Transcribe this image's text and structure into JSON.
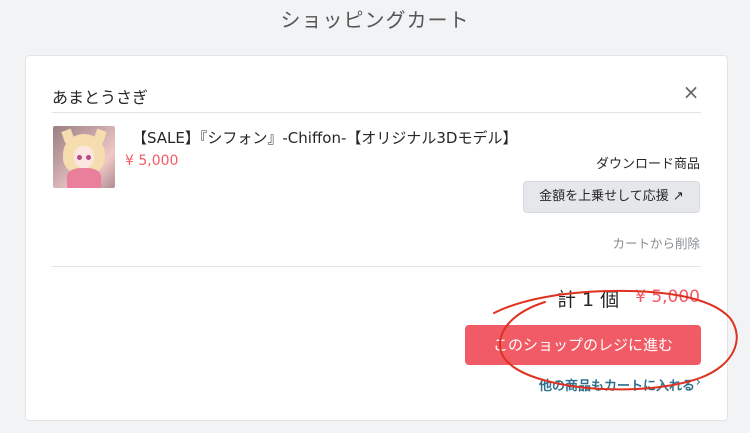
{
  "page": {
    "title": "ショッピングカート"
  },
  "shop": {
    "name": "あまとうさぎ",
    "close_icon": "×"
  },
  "item": {
    "title": "【SALE】『シフォン』-Chiffon-【オリジナル3Dモデル】",
    "price": "¥ 5,000",
    "type": "ダウンロード商品",
    "boost_label": "金額を上乗せして応援 ↗",
    "remove_label": "カートから削除"
  },
  "summary": {
    "count": "計 1 個",
    "total": "¥ 5,000"
  },
  "actions": {
    "checkout_label": "このショップのレジに進む",
    "continue_label": "他の商品もカートに入れる",
    "continue_arrow": "›"
  },
  "colors": {
    "accent": "#f15b66",
    "link": "#2e6f8e",
    "annotation": "#e0301e",
    "background": "#f2f3f4"
  }
}
